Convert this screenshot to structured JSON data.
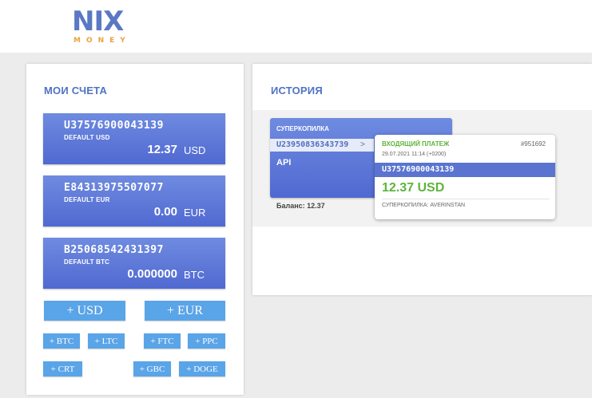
{
  "logo": {
    "main": "NIX",
    "sub": "MONEY"
  },
  "accounts_panel": {
    "title": "МОИ СЧЕТА",
    "accounts": [
      {
        "id": "U37576900043139",
        "label": "DEFAULT USD",
        "amount": "12.37",
        "currency": "USD"
      },
      {
        "id": "E84313975507077",
        "label": "DEFAULT EUR",
        "amount": "0.00",
        "currency": "EUR"
      },
      {
        "id": "B25068542431397",
        "label": "DEFAULT BTC",
        "amount": "0.000000",
        "currency": "BTC"
      }
    ],
    "buttons": {
      "add_usd": "+ USD",
      "add_eur": "+ EUR",
      "add_btc": "+ BTC",
      "add_ltc": "+ LTC",
      "add_ftc": "+ FTC",
      "add_ppc": "+ PPC",
      "add_crt": "+ CRT",
      "add_gbc": "+ GBC",
      "add_doge": "+ DOGE"
    }
  },
  "history_panel": {
    "title": "ИСТОРИЯ",
    "kopilka": {
      "title": "СУПЕРКОПИЛКА",
      "account": "U23950836343739",
      "arrow": ">",
      "api": "API",
      "balance": "Баланс: 12.37"
    },
    "payment": {
      "type": "ВХОДЯЩИЙ ПЛАТЕЖ",
      "id": "#951692",
      "date": "29.07.2021 11:14 (+0200)",
      "account": "U37576900043139",
      "amount": "12.37 USD",
      "source": "СУПЕРКОПИЛКА: AVERINSTAN"
    }
  },
  "colors": {
    "accent": "#4f73c4",
    "card": "#5b74d4",
    "button": "#5aa4e8",
    "success": "#5fb43c"
  }
}
